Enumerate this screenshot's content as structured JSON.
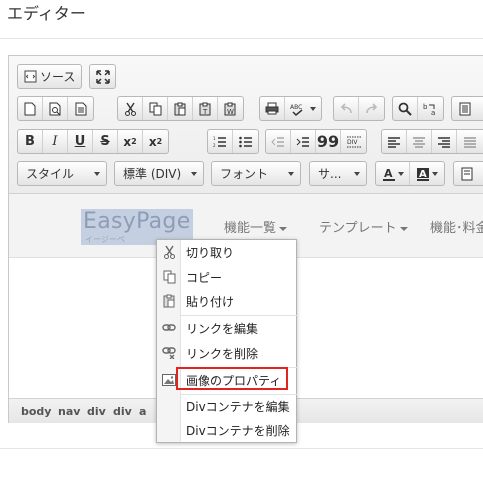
{
  "page": {
    "title": "エディター"
  },
  "toolbar": {
    "source_label": "ソース",
    "styles": {
      "style": "スタイル",
      "format": "標準 (DIV)",
      "font": "フォント",
      "size": "サ..."
    }
  },
  "editor": {
    "logo_main": "EasyPage",
    "logo_sub": "イージーペ",
    "nav": [
      "機能一覧",
      "テンプレート",
      "機能･料金"
    ],
    "path": [
      "body",
      "nav",
      "div",
      "div",
      "a"
    ]
  },
  "context_menu": {
    "items": [
      {
        "label": "切り取り",
        "icon": "scissors-icon"
      },
      {
        "label": "コピー",
        "icon": "copy-icon"
      },
      {
        "label": "貼り付け",
        "icon": "paste-icon"
      },
      {
        "label": "リンクを編集",
        "icon": "link-icon"
      },
      {
        "label": "リンクを削除",
        "icon": "unlink-icon"
      },
      {
        "label": "画像のプロパティ",
        "icon": "image-icon"
      },
      {
        "label": "Divコンテナを編集",
        "icon": ""
      },
      {
        "label": "Divコンテナを削除",
        "icon": ""
      }
    ],
    "highlight_color": "#e0251f"
  }
}
